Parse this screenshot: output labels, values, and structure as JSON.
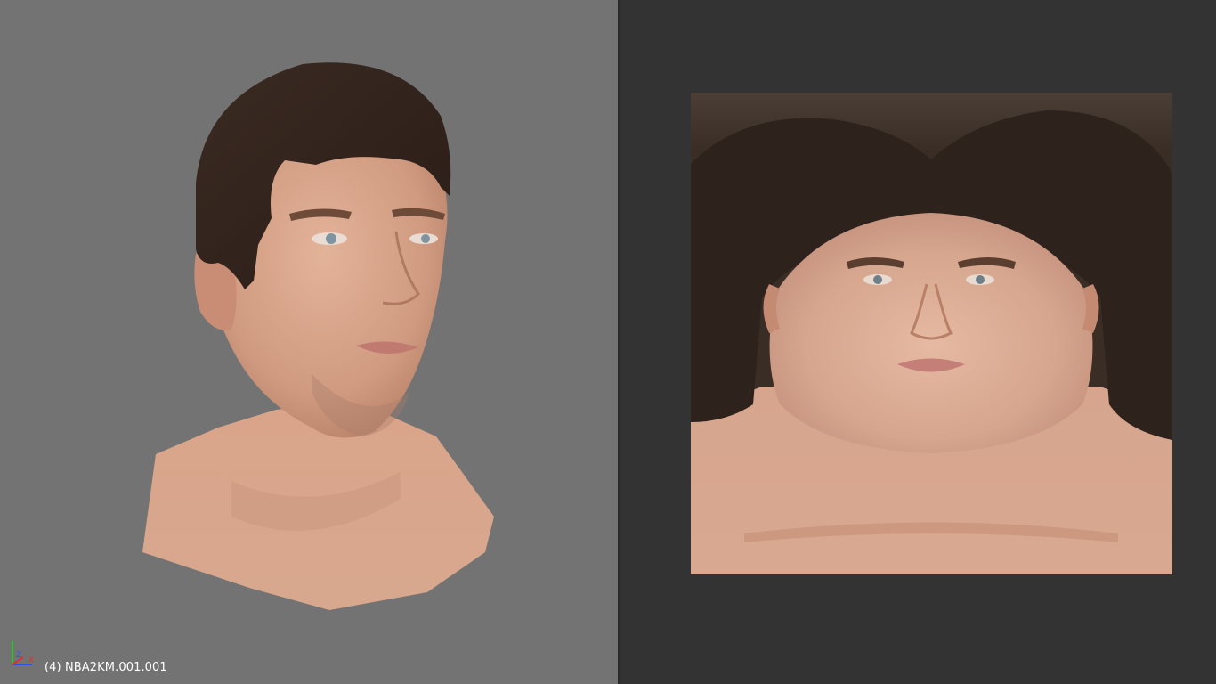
{
  "viewport": {
    "object_label": "(4) NBA2KM.001.001",
    "background_color": "#737373",
    "axis_gizmo": {
      "x": "X",
      "y": "Y",
      "z": "Z",
      "x_color": "#e03030",
      "y_color": "#30c030",
      "z_color": "#3050e0"
    }
  },
  "uv_editor": {
    "background_color": "#333333",
    "texture_image": "face-texture-map"
  }
}
